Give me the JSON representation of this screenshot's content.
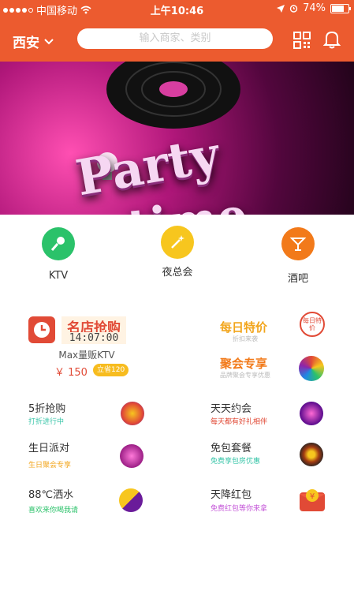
{
  "status": {
    "carrier": "中国移动",
    "time": "上午10:46",
    "battery": "74%"
  },
  "header": {
    "city": "西安",
    "search_placeholder": "输入商家、类别"
  },
  "banner": {
    "line1": "Party",
    "line2": "time"
  },
  "categories": [
    {
      "label": "KTV",
      "icon": "microphone-icon",
      "color": "#2bc26a"
    },
    {
      "label": "夜总会",
      "icon": "magic-wand-icon",
      "color": "#f7c61e"
    },
    {
      "label": "酒吧",
      "icon": "cocktail-icon",
      "color": "#f27a1a"
    }
  ],
  "flash_sale": {
    "title": "名店抢购",
    "timer": "14:07:00",
    "store": "Max量贩KTV",
    "price": "￥ 150",
    "save": "立省120"
  },
  "daily": {
    "title": "每日特价",
    "subtitle": "折扣来袭",
    "badge": "每日特价",
    "color": "#f2a51c"
  },
  "party": {
    "title": "聚会专享",
    "subtitle": "品牌聚会专享优惠",
    "color": "#f27a1a"
  },
  "items": [
    {
      "title": "5折抢购",
      "subtitle": "打折进行中",
      "subcolor": "#38c5a8"
    },
    {
      "title": "天天约会",
      "subtitle": "每天都有好礼相伴",
      "subcolor": "#e14a36"
    },
    {
      "title": "生日派对",
      "subtitle": "生日聚会专享",
      "subcolor": "#f2a51c"
    },
    {
      "title": "免包套餐",
      "subtitle": "免费享包房优惠",
      "subcolor": "#38c5a8"
    },
    {
      "title": "88℃洒水",
      "subtitle": "喜欢来你喝我请",
      "subcolor": "#2bc26a"
    },
    {
      "title": "天降红包",
      "subtitle": "免费红包等你来拿",
      "subcolor": "#c456d8"
    }
  ]
}
